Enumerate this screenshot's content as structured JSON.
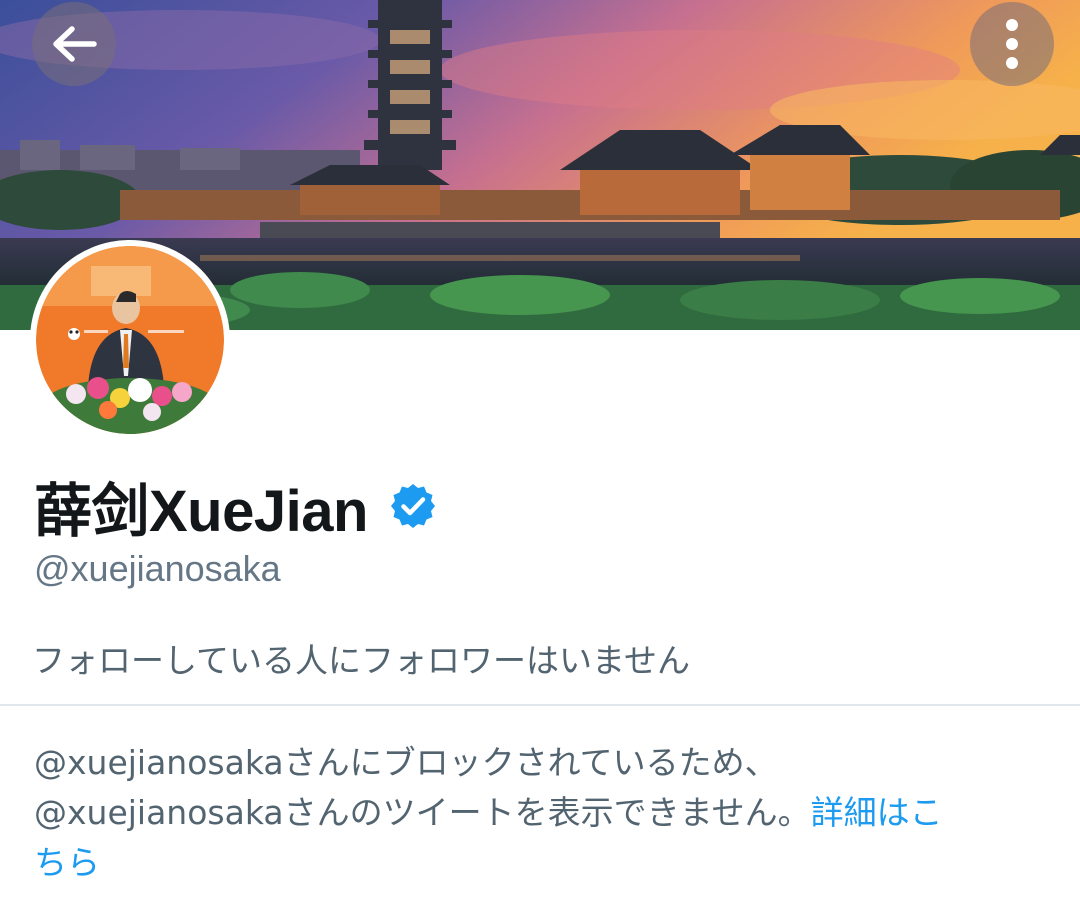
{
  "header": {
    "back_icon": "arrow-left-icon",
    "more_icon": "more-vertical-icon"
  },
  "profile": {
    "display_name": "薛剑XueJian",
    "verified_icon": "verified-badge-icon",
    "handle": "@xuejianosaka",
    "followers_note": "フォローしている人にフォロワーはいません"
  },
  "blocked": {
    "line1": "@xuejianosakaさんにブロックされているため、",
    "line2": "@xuejianosakaさんのツイートを表示できません。",
    "learn_more_part1": "詳細はこ",
    "learn_more_part2": "ちら"
  },
  "colors": {
    "accent": "#1d9bf0",
    "text_primary": "#14171a",
    "text_secondary": "#536471",
    "divider": "#e1e8ed"
  }
}
